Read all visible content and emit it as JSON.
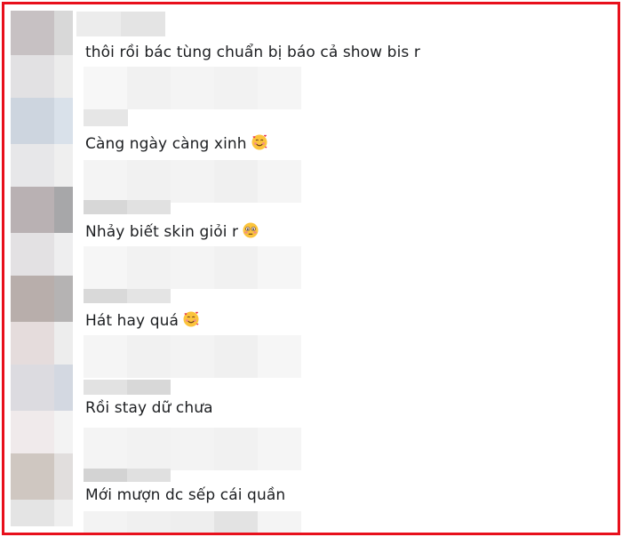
{
  "comments": [
    {
      "text": "thôi rồi bác tùng chuẩn bị báo cả show bis r",
      "emoji": ""
    },
    {
      "text": "Càng ngày càng xinh",
      "emoji": "smiling-face-with-hearts-icon"
    },
    {
      "text": "Nhảy biết skin giỏi r",
      "emoji": "flushed-face-icon"
    },
    {
      "text": "Hát hay quá",
      "emoji": "smiling-face-with-hearts-icon"
    },
    {
      "text": "Rồi stay dữ chưa",
      "emoji": ""
    },
    {
      "text": "Mới mượn dc sếp cái quần",
      "emoji": ""
    }
  ],
  "colors": {
    "frame_border": "#e8101c",
    "comment_text": "#1c1e21",
    "pixelation_light": "#f5f5f5",
    "pixelation_mid": "#ebebeb"
  }
}
